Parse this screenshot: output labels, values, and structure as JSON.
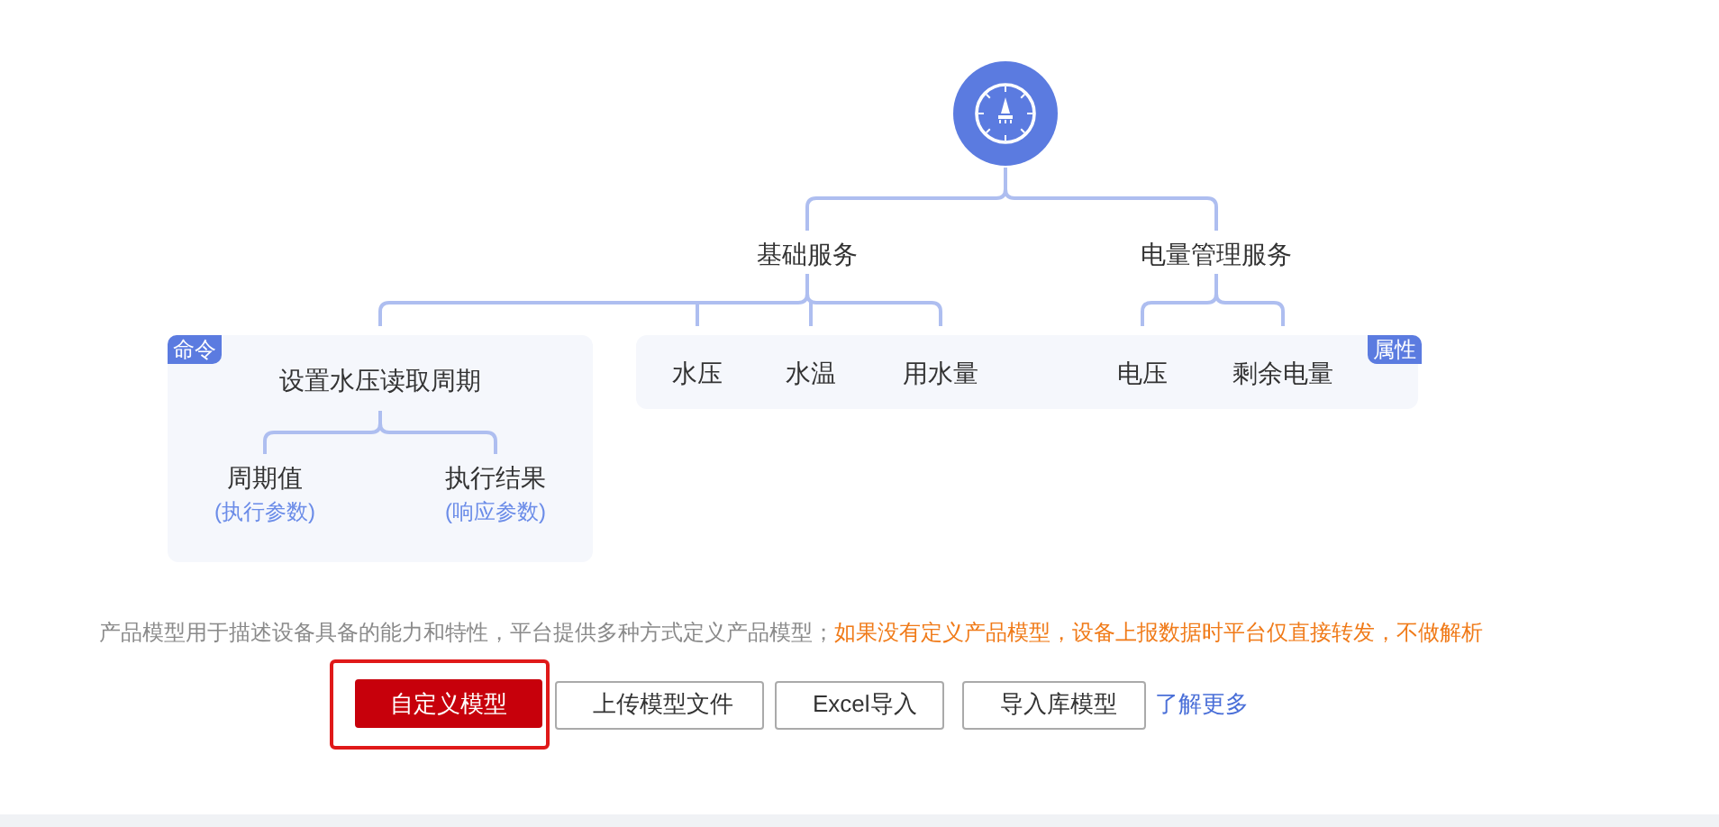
{
  "diagram": {
    "services": [
      {
        "name": "基础服务",
        "properties": [
          {
            "name": "水压"
          },
          {
            "name": "水温"
          },
          {
            "name": "用水量"
          }
        ],
        "command": {
          "badge": "命令",
          "name": "设置水压读取周期",
          "params": [
            {
              "name": "周期值",
              "role": "(执行参数)"
            },
            {
              "name": "执行结果",
              "role": "(响应参数)"
            }
          ]
        }
      },
      {
        "name": "电量管理服务",
        "properties": [
          {
            "name": "电压"
          },
          {
            "name": "剩余电量"
          }
        ]
      }
    ],
    "property_badge": "属性"
  },
  "description": {
    "text": "产品模型用于描述设备具备的能力和特性，平台提供多种方式定义产品模型；",
    "warning": "如果没有定义产品模型，设备上报数据时平台仅直接转发，不做解析"
  },
  "buttons": [
    {
      "label": "自定义模型",
      "selected": true
    },
    {
      "label": "上传模型文件",
      "selected": false
    },
    {
      "label": "Excel导入",
      "selected": false
    },
    {
      "label": "导入库模型",
      "selected": false
    }
  ],
  "link": "了解更多"
}
